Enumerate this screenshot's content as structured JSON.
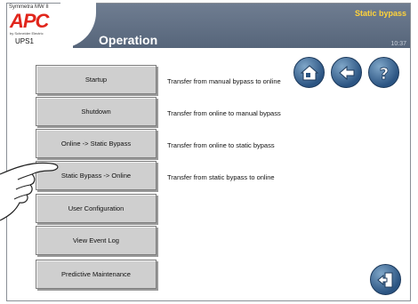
{
  "header": {
    "product_line": "Symmetra MW II",
    "brand": "APC",
    "brand_sub": "by Schneider Electric",
    "device": "UPS1",
    "title": "Operation",
    "status": "Static bypass",
    "time": "10:37"
  },
  "menu": [
    {
      "label": "Startup",
      "description": "Transfer from manual bypass to online"
    },
    {
      "label": "Shutdown",
      "description": "Transfer from online to manual bypass"
    },
    {
      "label": "Online -> Static Bypass",
      "description": "Transfer from online to static bypass"
    },
    {
      "label": "Static Bypass -> Online",
      "description": "Transfer from static bypass to online"
    },
    {
      "label": "User Configuration",
      "description": ""
    },
    {
      "label": "View Event Log",
      "description": ""
    },
    {
      "label": "Predictive Maintenance",
      "description": ""
    }
  ],
  "nav_icons": [
    "home-icon",
    "back-arrow-icon",
    "help-icon",
    "exit-door-icon"
  ],
  "colors": {
    "header": "#5d6c81",
    "status": "#ffd33a",
    "brand": "#e1261c",
    "button": "#cfcfcf",
    "icon": "#2b5482"
  }
}
